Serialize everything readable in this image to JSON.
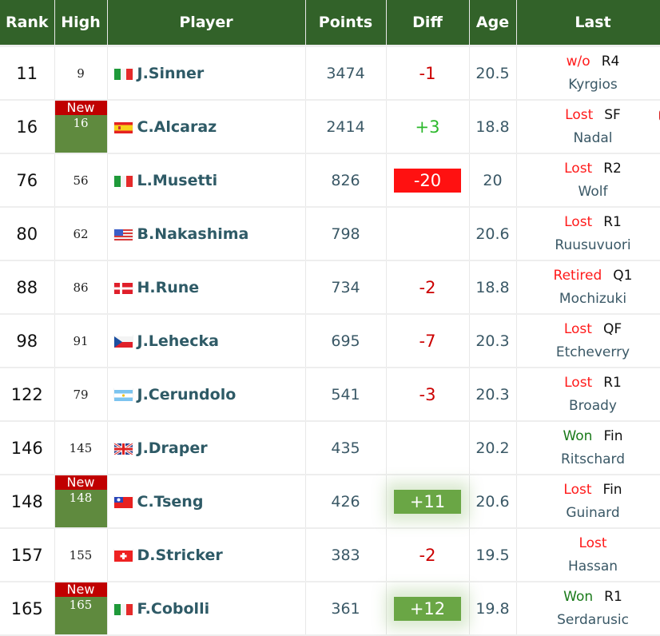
{
  "headers": {
    "rank": "Rank",
    "high": "High",
    "player": "Player",
    "points": "Points",
    "diff": "Diff",
    "age": "Age",
    "last": "Last"
  },
  "new_label": "New",
  "colors": {
    "header_bg": "#326229",
    "new_tag": "#c00000",
    "new_cell": "#5f8a3e",
    "diff_neg": "#cc0000",
    "diff_pos": "#2cb82c",
    "big_drop": "#ff1111",
    "big_rise": "#6aa645"
  },
  "rows": [
    {
      "rank": "11",
      "high": "9",
      "is_new": false,
      "flag": "italy-flag-icon",
      "player": "J.Sinner",
      "points": "3474",
      "diff": "-1",
      "diff_style": "neg",
      "age": "20.5",
      "result": "w/o",
      "result_type": "loss",
      "round": "R4",
      "opponent": "Kyrgios",
      "video": false
    },
    {
      "rank": "16",
      "high": "16",
      "is_new": true,
      "flag": "spain-flag-icon",
      "player": "C.Alcaraz",
      "points": "2414",
      "diff": "+3",
      "diff_style": "pos",
      "age": "18.8",
      "result": "Lost",
      "result_type": "loss",
      "round": "SF",
      "opponent": "Nadal",
      "video": true
    },
    {
      "rank": "76",
      "high": "56",
      "is_new": false,
      "flag": "italy-flag-icon",
      "player": "L.Musetti",
      "points": "826",
      "diff": "-20",
      "diff_style": "big-neg",
      "age": "20",
      "result": "Lost",
      "result_type": "loss",
      "round": "R2",
      "opponent": "Wolf",
      "video": false
    },
    {
      "rank": "80",
      "high": "62",
      "is_new": false,
      "flag": "usa-flag-icon",
      "player": "B.Nakashima",
      "points": "798",
      "diff": "",
      "diff_style": "none",
      "age": "20.6",
      "result": "Lost",
      "result_type": "loss",
      "round": "R1",
      "opponent": "Ruusuvuori",
      "video": false
    },
    {
      "rank": "88",
      "high": "86",
      "is_new": false,
      "flag": "denmark-flag-icon",
      "player": "H.Rune",
      "points": "734",
      "diff": "-2",
      "diff_style": "neg",
      "age": "18.8",
      "result": "Retired",
      "result_type": "loss",
      "round": "Q1",
      "opponent": "Mochizuki",
      "video": false
    },
    {
      "rank": "98",
      "high": "91",
      "is_new": false,
      "flag": "czech-flag-icon",
      "player": "J.Lehecka",
      "points": "695",
      "diff": "-7",
      "diff_style": "neg",
      "age": "20.3",
      "result": "Lost",
      "result_type": "loss",
      "round": "QF",
      "opponent": "Etcheverry",
      "video": false
    },
    {
      "rank": "122",
      "high": "79",
      "is_new": false,
      "flag": "argentina-flag-icon",
      "player": "J.Cerundolo",
      "points": "541",
      "diff": "-3",
      "diff_style": "neg",
      "age": "20.3",
      "result": "Lost",
      "result_type": "loss",
      "round": "R1",
      "opponent": "Broady",
      "video": false
    },
    {
      "rank": "146",
      "high": "145",
      "is_new": false,
      "flag": "uk-flag-icon",
      "player": "J.Draper",
      "points": "435",
      "diff": "",
      "diff_style": "none",
      "age": "20.2",
      "result": "Won",
      "result_type": "won",
      "round": "Fin",
      "opponent": "Ritschard",
      "video": false
    },
    {
      "rank": "148",
      "high": "148",
      "is_new": true,
      "flag": "taiwan-flag-icon",
      "player": "C.Tseng",
      "points": "426",
      "diff": "+11",
      "diff_style": "big-pos",
      "age": "20.6",
      "result": "Lost",
      "result_type": "loss",
      "round": "Fin",
      "opponent": "Guinard",
      "video": false
    },
    {
      "rank": "157",
      "high": "155",
      "is_new": false,
      "flag": "switzerland-flag-icon",
      "player": "D.Stricker",
      "points": "383",
      "diff": "-2",
      "diff_style": "neg",
      "age": "19.5",
      "result": "Lost",
      "result_type": "loss",
      "round": "",
      "opponent": "Hassan",
      "video": false
    },
    {
      "rank": "165",
      "high": "165",
      "is_new": true,
      "flag": "italy-flag-icon",
      "player": "F.Cobolli",
      "points": "361",
      "diff": "+12",
      "diff_style": "big-pos",
      "age": "19.8",
      "result": "Won",
      "result_type": "won",
      "round": "R1",
      "opponent": "Serdarusic",
      "video": false
    }
  ]
}
